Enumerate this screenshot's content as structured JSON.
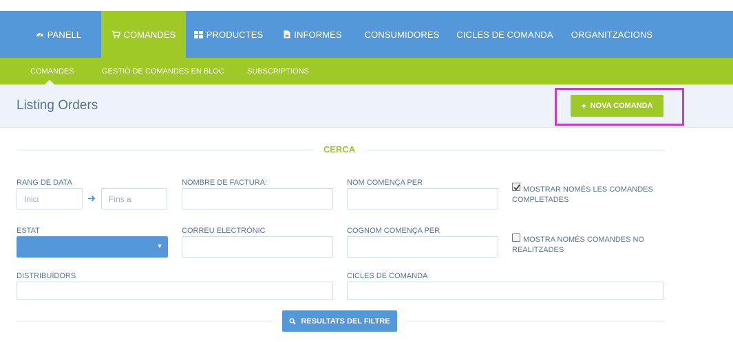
{
  "topnav": {
    "items": [
      {
        "label": "PANELL",
        "icon": "dashboard-icon"
      },
      {
        "label": "COMANDES",
        "icon": "cart-icon",
        "active": true
      },
      {
        "label": "PRODUCTES",
        "icon": "grid-icon"
      },
      {
        "label": "INFORMES",
        "icon": "document-icon"
      },
      {
        "label": "CONSUMIDORES"
      },
      {
        "label": "CICLES DE COMANDA"
      },
      {
        "label": "ORGANITZACIONS"
      }
    ]
  },
  "subnav": {
    "items": [
      {
        "label": "COMANDES",
        "active": true
      },
      {
        "label": "GESTIÓ DE COMANDES EN BLOC"
      },
      {
        "label": "SUBSCRIPTIONS"
      }
    ]
  },
  "header": {
    "title": "Listing Orders",
    "new_button_label": "NOVA COMANDA"
  },
  "search": {
    "section_title": "CERCA",
    "date_range_label": "RANG DE DATA",
    "date_from_placeholder": "Inici",
    "date_to_placeholder": "Fins a",
    "invoice_number_label": "NOMBRE DE FACTURA:",
    "first_name_label": "NOM COMENÇA PER",
    "show_completed_label": "MOSTRAR NOMÉS LES COMANDES COMPLETADES",
    "show_completed_checked": true,
    "status_label": "ESTAT",
    "status_value": "",
    "email_label": "CORREU ELECTRÒNIC",
    "last_name_label": "COGNOM COMENÇA PER",
    "show_uncompleted_label": "MOSTRA NOMÉS COMANDES NO REALITZADES",
    "show_uncompleted_checked": false,
    "distributors_label": "DISTRIBUÏDORS",
    "order_cycles_label": "CICLES DE COMANDA",
    "filter_button_label": "RESULTATS DEL FILTRE"
  },
  "colors": {
    "primary_blue": "#5498da",
    "accent_green": "#9fc926",
    "highlight_magenta": "#c740b7",
    "label_text": "#577591",
    "title_bar_bg": "#edf3f9"
  }
}
